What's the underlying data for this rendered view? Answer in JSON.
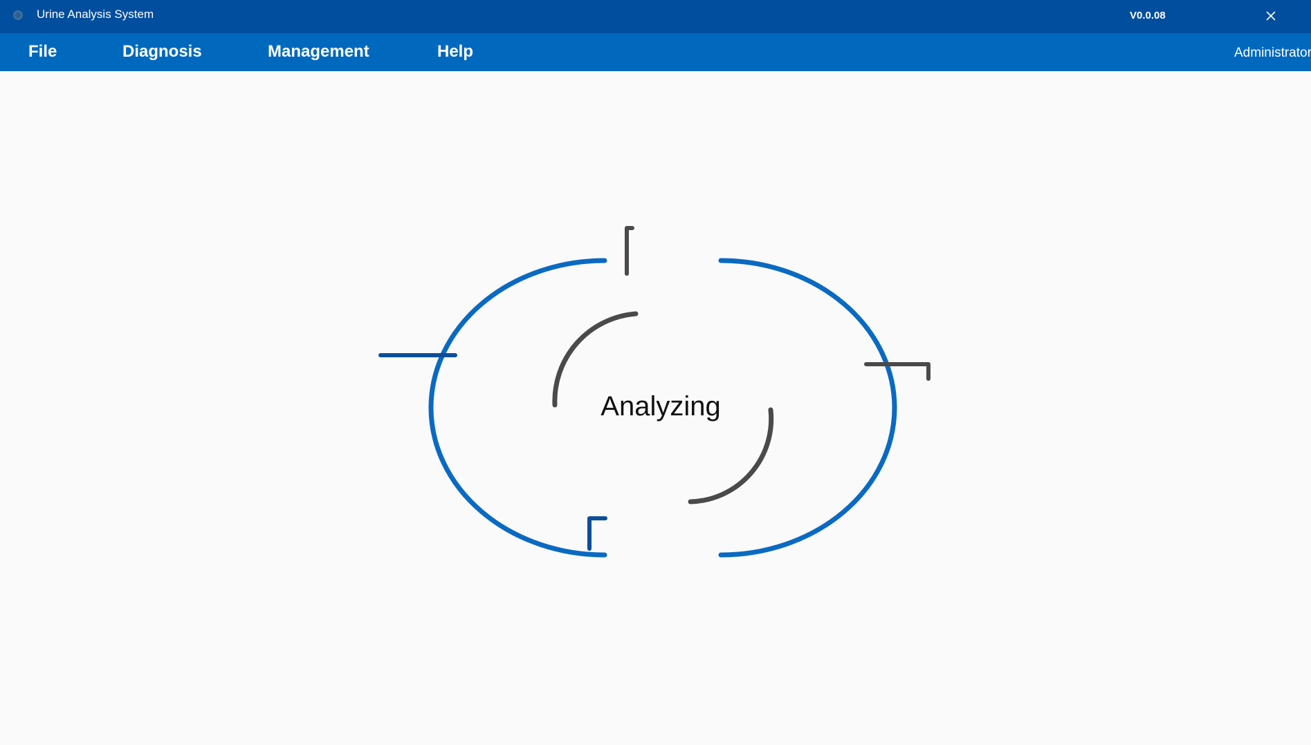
{
  "window": {
    "title": "Urine Analysis System",
    "version": "V0.0.08",
    "icons": {
      "app": "app-icon",
      "close": "close-icon"
    }
  },
  "menubar": {
    "items": [
      {
        "label": "File"
      },
      {
        "label": "Diagnosis"
      },
      {
        "label": "Management"
      },
      {
        "label": "Help"
      }
    ],
    "user": "Administrator"
  },
  "loader": {
    "status_text": "Analyzing",
    "icon": "loading-spinner-icon"
  },
  "colors": {
    "titlebar": "#004e9d",
    "menubar": "#0069be",
    "spinner_blue": "#0a6ac2",
    "spinner_dark_blue": "#0b4f99",
    "spinner_gray": "#4a4a4a",
    "background": "#fafafa"
  }
}
